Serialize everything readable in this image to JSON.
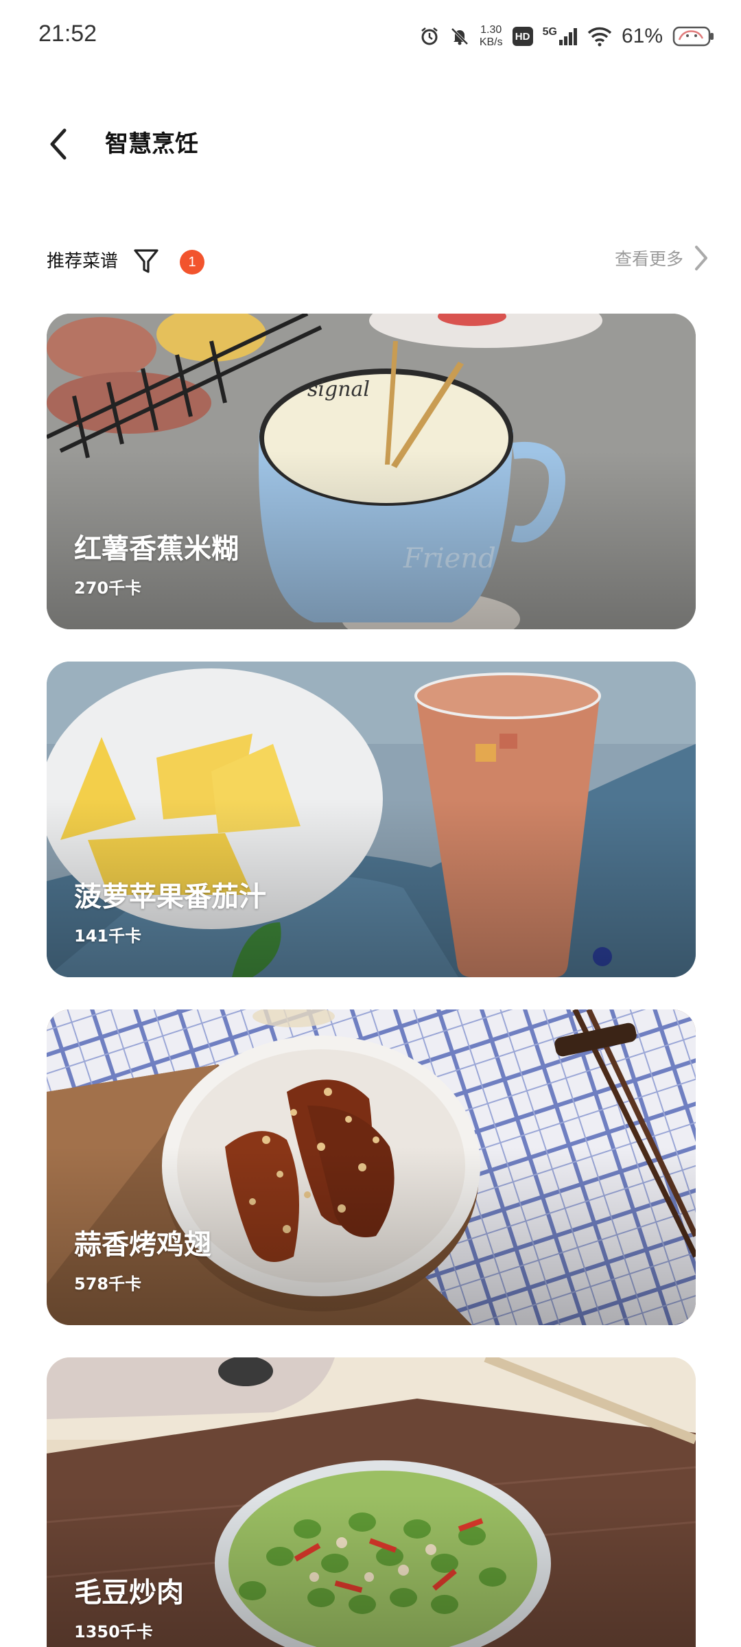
{
  "status_bar": {
    "time": "21:52",
    "net_speed_value": "1.30",
    "net_speed_unit": "KB/s",
    "hd_label": "HD",
    "network_label": "5G",
    "battery": "61%",
    "icons": [
      "alarm-icon",
      "mute-bell-icon",
      "hd-icon",
      "signal-icon",
      "wifi-icon",
      "battery-icon"
    ]
  },
  "header": {
    "title": "智慧烹饪",
    "back_icon": "chevron-left-icon"
  },
  "section": {
    "title": "推荐菜谱",
    "filter_icon": "filter-icon",
    "filter_count": "1",
    "see_more": "查看更多",
    "see_more_icon": "chevron-right-icon",
    "accent_color": "#f2542d"
  },
  "recipes": [
    {
      "name": "红薯香蕉米糊",
      "calories": "270千卡"
    },
    {
      "name": "菠萝苹果番茄汁",
      "calories": "141千卡"
    },
    {
      "name": "蒜香烤鸡翅",
      "calories": "578千卡"
    },
    {
      "name": "毛豆炒肉",
      "calories": "1350千卡"
    }
  ]
}
